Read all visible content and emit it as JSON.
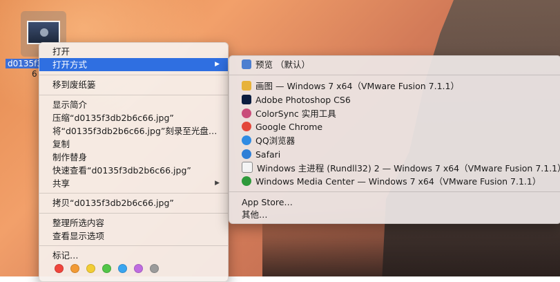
{
  "desktop": {
    "file_name": "d0135f3db2b6c66.jpg",
    "file_name_line2": "6"
  },
  "context_menu": {
    "items": [
      {
        "label": "打开"
      },
      {
        "label": "打开方式",
        "selected": true,
        "has_submenu": true
      },
      {
        "label": "移到废纸篓"
      },
      {
        "label": "显示简介"
      },
      {
        "label": "压缩“d0135f3db2b6c66.jpg”"
      },
      {
        "label": "将“d0135f3db2b6c66.jpg”刻录至光盘…"
      },
      {
        "label": "复制"
      },
      {
        "label": "制作替身"
      },
      {
        "label": "快速查看“d0135f3db2b6c66.jpg”"
      },
      {
        "label": "共享",
        "has_submenu": true
      },
      {
        "label": "拷贝“d0135f3db2b6c66.jpg”"
      },
      {
        "label": "整理所选内容"
      },
      {
        "label": "查看显示选项"
      },
      {
        "label": "标记…"
      }
    ],
    "submenu_arrow": "▶",
    "tag_colors": [
      "#f0453c",
      "#f29a35",
      "#f2cd35",
      "#53c548",
      "#3aa5f0",
      "#bf6ce0",
      "#9b9b9b"
    ]
  },
  "open_with_submenu": {
    "items": [
      {
        "label": "预览 （默认）",
        "icon": "preview-icon",
        "color": "#4d7fd0"
      },
      {
        "label": "画图 — Windows 7 x64（VMware Fusion 7.1.1）",
        "icon": "paint-icon",
        "color": "#e7b23a"
      },
      {
        "label": "Adobe Photoshop CS6",
        "icon": "photoshop-icon",
        "color": "#0a1c3f"
      },
      {
        "label": "ColorSync 实用工具",
        "icon": "colorsync-icon",
        "color": "#c94d7a"
      },
      {
        "label": "Google Chrome",
        "icon": "chrome-icon",
        "color": "#e3473a"
      },
      {
        "label": "QQ浏览器",
        "icon": "qq-browser-icon",
        "color": "#2f8be3"
      },
      {
        "label": "Safari",
        "icon": "safari-icon",
        "color": "#2f7fd6"
      },
      {
        "label": "Windows 主进程 (Rundll32) 2 — Windows 7 x64（VMware Fusion 7.1.1）",
        "icon": "windows-host-icon",
        "color": "#f4f4f4"
      },
      {
        "label": "Windows Media Center — Windows 7 x64（VMware Fusion 7.1.1）",
        "icon": "media-center-icon",
        "color": "#2e9a3b"
      },
      {
        "label": "App Store…",
        "icon": "",
        "color": ""
      },
      {
        "label": "其他…",
        "icon": "",
        "color": ""
      }
    ]
  }
}
